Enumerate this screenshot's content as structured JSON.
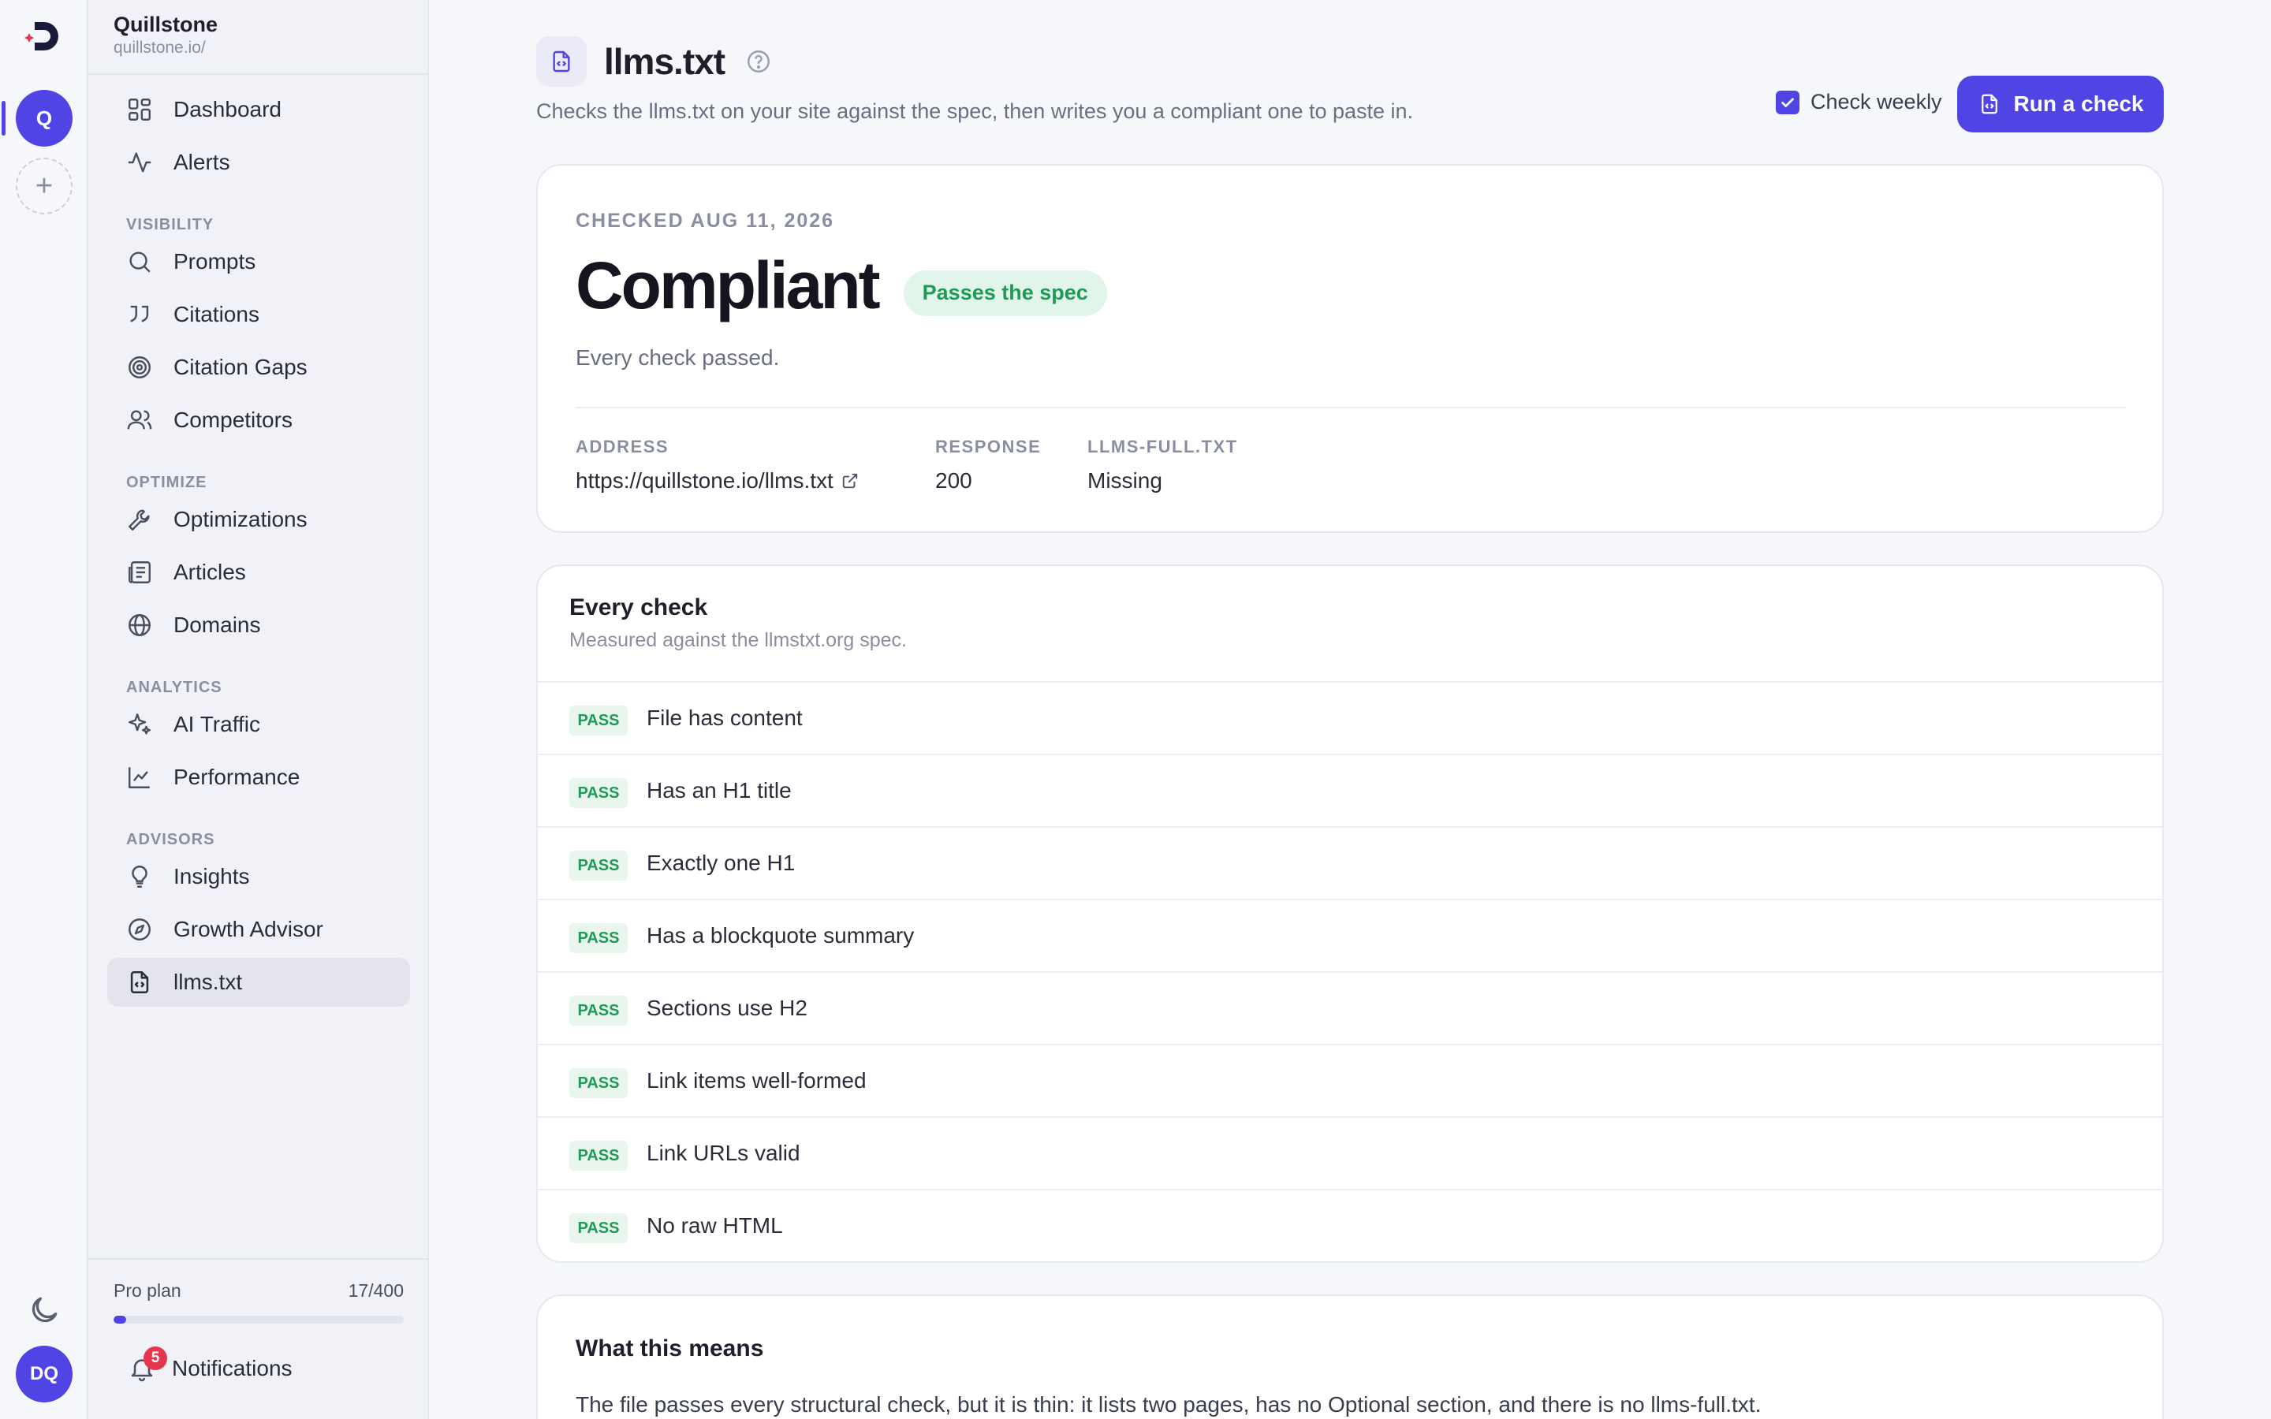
{
  "rail": {
    "workspace_initial": "Q",
    "add_symbol": "+",
    "user_initials": "DQ"
  },
  "org": {
    "name": "Quillstone",
    "url": "quillstone.io/"
  },
  "nav": {
    "dashboard": "Dashboard",
    "alerts": "Alerts",
    "group_visibility": "VISIBILITY",
    "prompts": "Prompts",
    "citations": "Citations",
    "citation_gaps": "Citation Gaps",
    "competitors": "Competitors",
    "group_optimize": "OPTIMIZE",
    "optimizations": "Optimizations",
    "articles": "Articles",
    "domains": "Domains",
    "group_analytics": "ANALYTICS",
    "ai_traffic": "AI Traffic",
    "performance": "Performance",
    "group_advisors": "ADVISORS",
    "insights": "Insights",
    "growth_advisor": "Growth Advisor",
    "llms_txt": "llms.txt"
  },
  "plan": {
    "label": "Pro plan",
    "usage": "17/400",
    "used": 17,
    "limit": 400
  },
  "notifications": {
    "label": "Notifications",
    "count": "5"
  },
  "page": {
    "title": "llms.txt",
    "subtitle": "Checks the llms.txt on your site against the spec, then writes you a compliant one to paste in.",
    "check_weekly_label": "Check weekly",
    "check_weekly_checked": true,
    "run_button": "Run a check"
  },
  "status": {
    "checked": "CHECKED AUG 11, 2026",
    "title": "Compliant",
    "pill": "Passes the spec",
    "description": "Every check passed.",
    "address_label": "ADDRESS",
    "address_value": "https://quillstone.io/llms.txt",
    "response_label": "RESPONSE",
    "response_value": "200",
    "full_label": "LLMS-FULL.TXT",
    "full_value": "Missing"
  },
  "checks": {
    "title": "Every check",
    "subtitle": "Measured against the llmstxt.org spec.",
    "items": [
      {
        "result": "PASS",
        "label": "File has content"
      },
      {
        "result": "PASS",
        "label": "Has an H1 title"
      },
      {
        "result": "PASS",
        "label": "Exactly one H1"
      },
      {
        "result": "PASS",
        "label": "Has a blockquote summary"
      },
      {
        "result": "PASS",
        "label": "Sections use H2"
      },
      {
        "result": "PASS",
        "label": "Link items well-formed"
      },
      {
        "result": "PASS",
        "label": "Link URLs valid"
      },
      {
        "result": "PASS",
        "label": "No raw HTML"
      }
    ]
  },
  "means": {
    "title": "What this means",
    "text": "The file passes every structural check, but it is thin: it lists two pages, has no Optional section, and there is no llms-full.txt."
  },
  "colors": {
    "accent": "#5044e4",
    "pass_green": "#1f9a57",
    "pass_bg": "#e8f6ee",
    "badge_red": "#e5364f"
  }
}
